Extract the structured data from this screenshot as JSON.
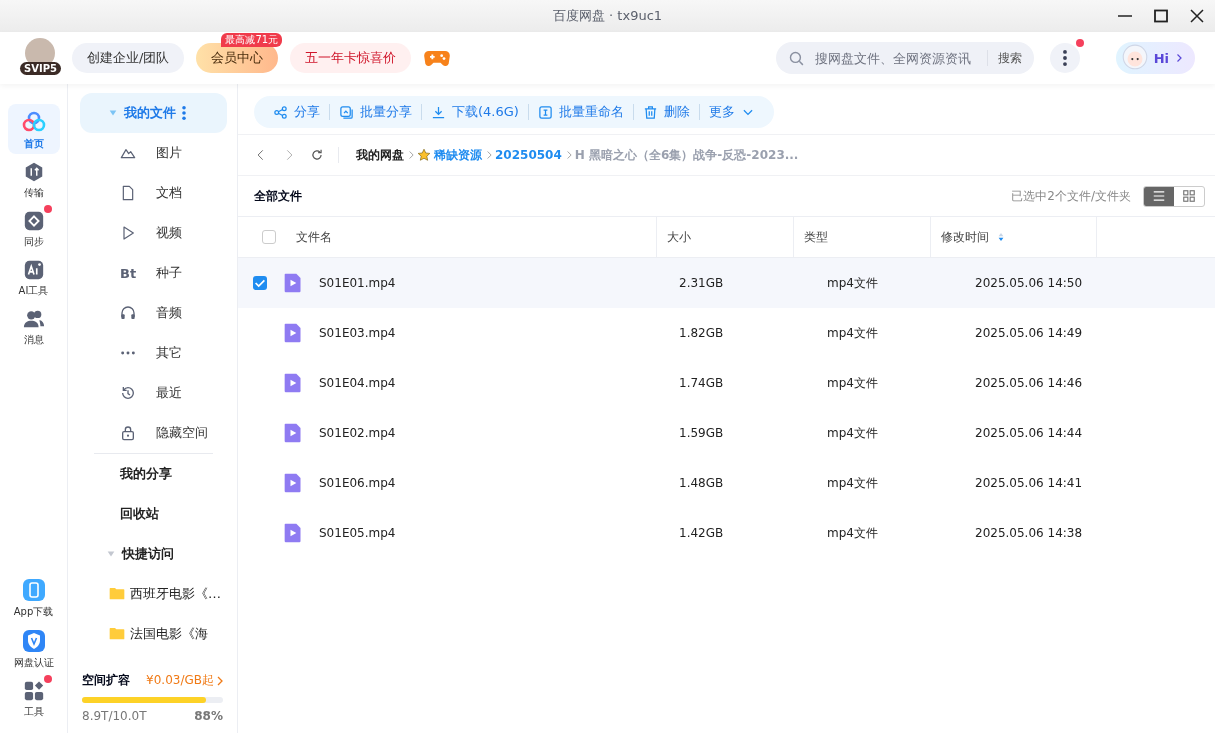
{
  "window": {
    "title": "百度网盘 · tx9uc1"
  },
  "header": {
    "vip_badge": "SVIP5",
    "buttons": [
      {
        "label": "创建企业/团队",
        "kind": "plain"
      },
      {
        "label": "会员中心",
        "kind": "vip",
        "tag": "最高减71元"
      },
      {
        "label": "五一年卡惊喜价",
        "kind": "promo"
      }
    ],
    "search": {
      "placeholder": "搜网盘文件、全网资源资讯",
      "button": "搜索"
    },
    "more_notification": true,
    "assistant": "Hi"
  },
  "rail": {
    "top": [
      {
        "label": "首页",
        "selected": true,
        "dot": false
      },
      {
        "label": "传输",
        "selected": false,
        "dot": false
      },
      {
        "label": "同步",
        "selected": false,
        "dot": true
      },
      {
        "label": "AI工具",
        "selected": false,
        "dot": false
      },
      {
        "label": "消息",
        "selected": false,
        "dot": false
      }
    ],
    "bottom": [
      {
        "label": "App下载",
        "selected": false,
        "dot": false
      },
      {
        "label": "网盘认证",
        "selected": false,
        "dot": false
      },
      {
        "label": "工具",
        "selected": false,
        "dot": true
      }
    ]
  },
  "sidebar": {
    "my_files": {
      "label": "我的文件",
      "selected": true,
      "expanded": true,
      "children": [
        {
          "label": "图片"
        },
        {
          "label": "文档"
        },
        {
          "label": "视频"
        },
        {
          "label": "种子",
          "glyph": "Bt"
        },
        {
          "label": "音频"
        },
        {
          "label": "其它"
        },
        {
          "label": "最近"
        },
        {
          "label": "隐藏空间"
        }
      ]
    },
    "links": [
      "我的分享",
      "回收站"
    ],
    "quick": {
      "label": "快捷访问",
      "expanded": true,
      "children": [
        "西班牙电影《…",
        "法国电影《海"
      ]
    },
    "storage": {
      "title": "空间扩容",
      "offer": "¥0.03/GB起",
      "level": 0.88,
      "used": "8.9T/10.0T",
      "percent": "88%"
    }
  },
  "toolbar": [
    {
      "label": "分享",
      "kind": "action"
    },
    {
      "label": "批量分享",
      "kind": "action"
    },
    {
      "label": "下载(4.6G)",
      "kind": "action"
    },
    {
      "label": "批量重命名",
      "kind": "action"
    },
    {
      "label": "删除",
      "kind": "action"
    },
    {
      "label": "更多",
      "kind": "menu"
    }
  ],
  "breadcrumb": [
    {
      "label": "我的网盘",
      "kind": "root",
      "star": false
    },
    {
      "label": "稀缺资源",
      "kind": "link",
      "star": true
    },
    {
      "label": "20250504",
      "kind": "link",
      "star": false
    },
    {
      "label": "H 黑暗之心（全6集）战争-反恐-2023...",
      "kind": "current",
      "star": false
    }
  ],
  "list_title": "全部文件",
  "selection_info": "已选中2个文件/文件夹",
  "view_toggles": [
    {
      "kind": "list",
      "selected": true
    },
    {
      "kind": "grid",
      "selected": false
    }
  ],
  "table": {
    "all_checked": false,
    "columns": [
      {
        "label": "文件名",
        "sorted": false
      },
      {
        "label": "大小",
        "sorted": false
      },
      {
        "label": "类型",
        "sorted": false
      },
      {
        "label": "修改时间",
        "sorted": true
      }
    ],
    "rows": [
      {
        "name": "S01E01.mp4",
        "size": "2.31GB",
        "type": "mp4文件",
        "modified": "2025.05.06 14:50",
        "checked": true
      },
      {
        "name": "S01E03.mp4",
        "size": "1.82GB",
        "type": "mp4文件",
        "modified": "2025.05.06 14:49",
        "checked": false
      },
      {
        "name": "S01E04.mp4",
        "size": "1.74GB",
        "type": "mp4文件",
        "modified": "2025.05.06 14:46",
        "checked": false
      },
      {
        "name": "S01E02.mp4",
        "size": "1.59GB",
        "type": "mp4文件",
        "modified": "2025.05.06 14:44",
        "checked": false
      },
      {
        "name": "S01E06.mp4",
        "size": "1.48GB",
        "type": "mp4文件",
        "modified": "2025.05.06 14:41",
        "checked": false
      },
      {
        "name": "S01E05.mp4",
        "size": "1.42GB",
        "type": "mp4文件",
        "modified": "2025.05.06 14:38",
        "checked": false
      }
    ]
  }
}
